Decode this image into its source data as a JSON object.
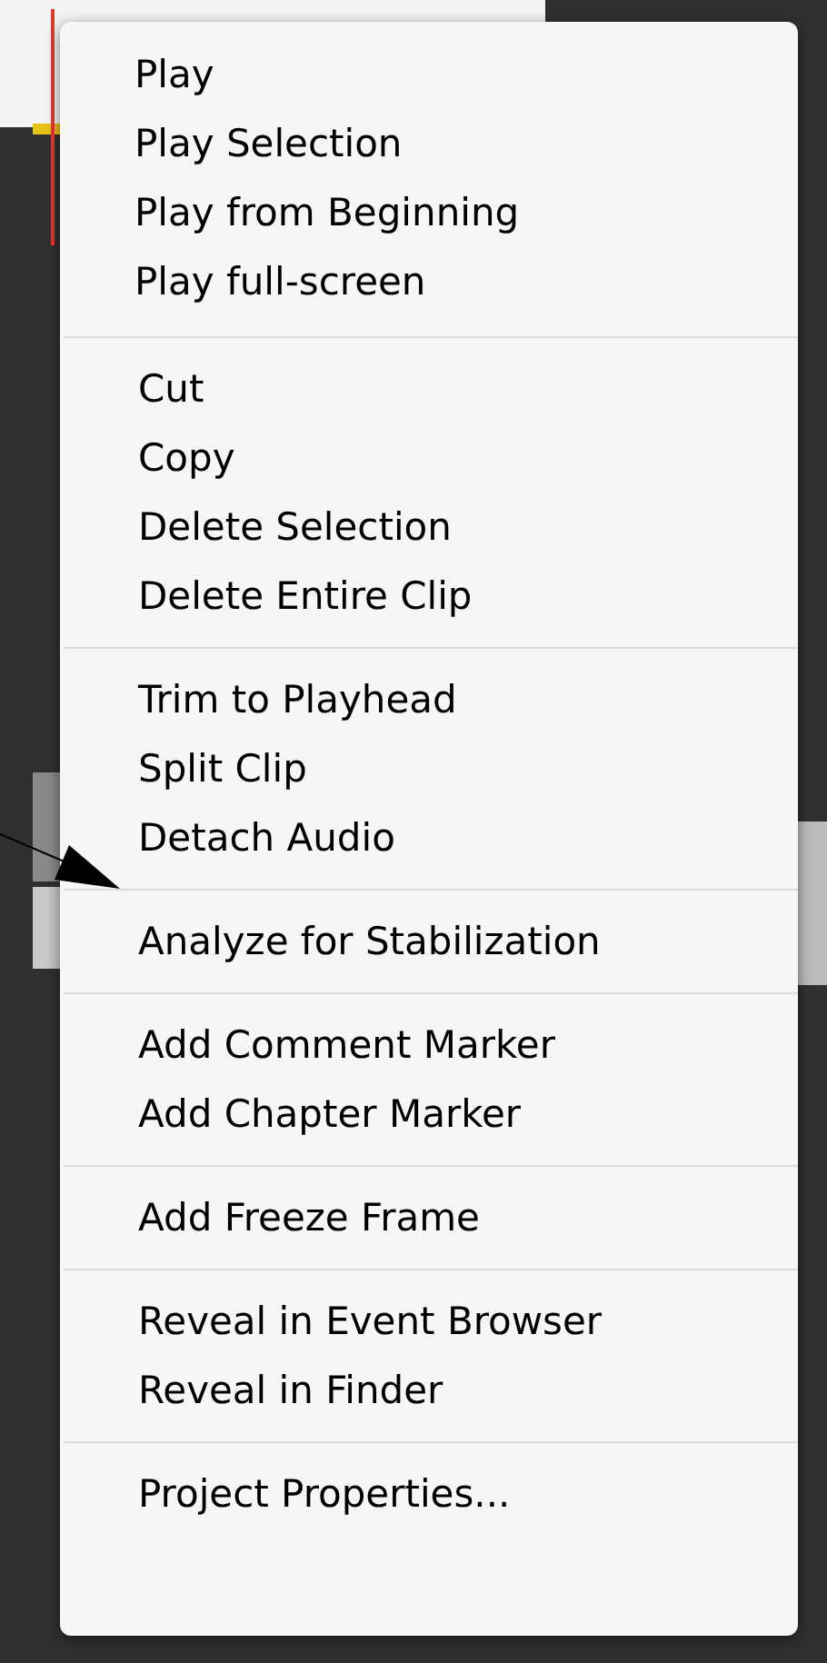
{
  "context_menu": {
    "groups": [
      {
        "items": [
          "Play",
          "Play Selection",
          "Play from Beginning",
          "Play full-screen"
        ]
      },
      {
        "items": [
          "Cut",
          "Copy",
          "Delete Selection",
          "Delete Entire Clip"
        ]
      },
      {
        "items": [
          "Trim to Playhead",
          "Split Clip",
          "Detach Audio"
        ]
      },
      {
        "items": [
          "Analyze for Stabilization"
        ]
      },
      {
        "items": [
          "Add Comment Marker",
          "Add Chapter Marker"
        ]
      },
      {
        "items": [
          "Add Freeze Frame"
        ]
      },
      {
        "items": [
          "Reveal in Event Browser",
          "Reveal in Finder"
        ]
      },
      {
        "items": [
          "Project Properties..."
        ]
      }
    ]
  }
}
